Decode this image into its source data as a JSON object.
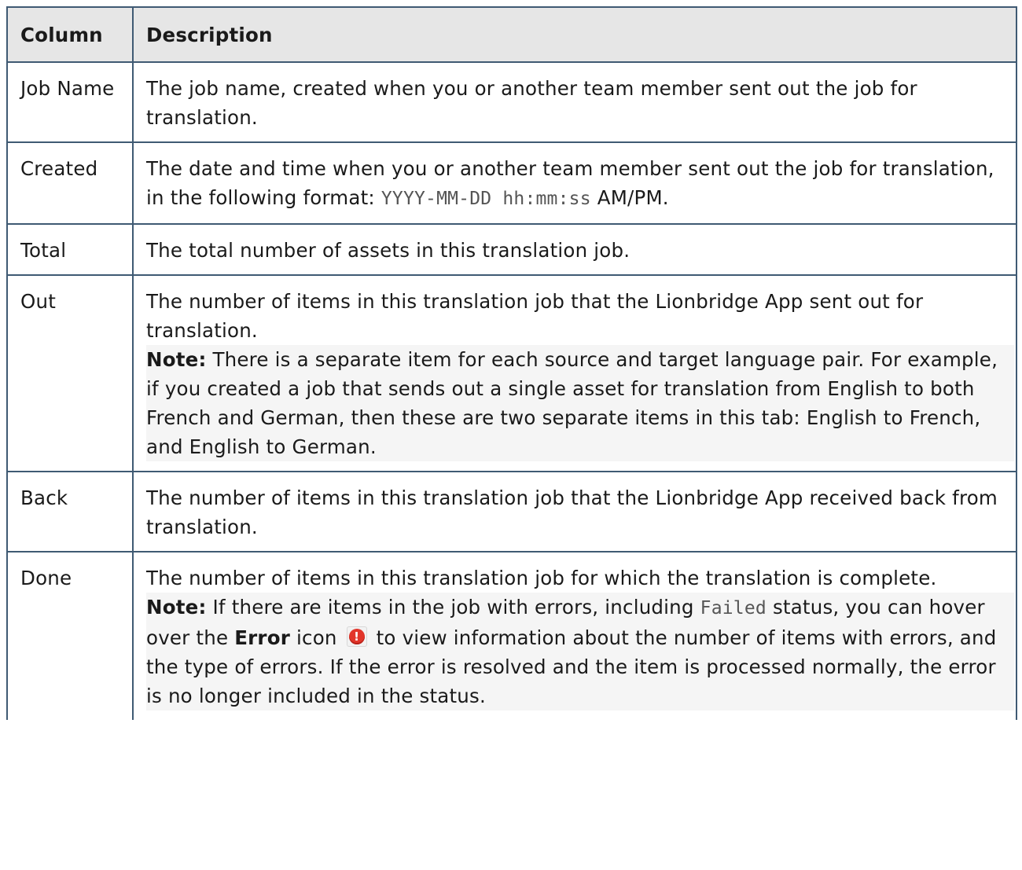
{
  "table": {
    "header": {
      "column": "Column",
      "description": "Description"
    },
    "rows": [
      {
        "name": "Job Name",
        "desc": "The job name, created when you or another team member sent out the job for translation."
      },
      {
        "name": "Created",
        "desc_before": "The date and time when you or another team member sent out the job for translation, in the following format: ",
        "desc_code": "YYYY-MM-DD hh:mm:ss",
        "desc_after": " AM/PM."
      },
      {
        "name": "Total",
        "desc": "The total number of assets in this translation job."
      },
      {
        "name": "Out",
        "desc": "The number of items in this translation job that the Lionbridge App sent out for translation.",
        "note_label": "Note:",
        "note_text": " There is a separate item for each source and target language pair. For example, if you created a job that sends out a single asset for translation from English to both French and German, then these are two separate items in this tab: English to French, and English to German."
      },
      {
        "name": "Back",
        "desc": "The number of items in this translation job that the Lionbridge App received back from translation."
      },
      {
        "name": "Done",
        "desc": "The number of items in this translation job for which the translation is complete.",
        "note_label": "Note:",
        "note_part1": " If there are items in the job with errors, including ",
        "note_code": "Failed",
        "note_part2": " status, you can hover over the ",
        "note_bold": "Error",
        "note_part3": " icon ",
        "note_part4": " to view information about the number of items with errors, and the type of errors. If the error is resolved and the item is processed normally, the error is no longer included in the status."
      }
    ]
  },
  "icons": {
    "error": "error-icon",
    "error_color": "#e2352a"
  }
}
